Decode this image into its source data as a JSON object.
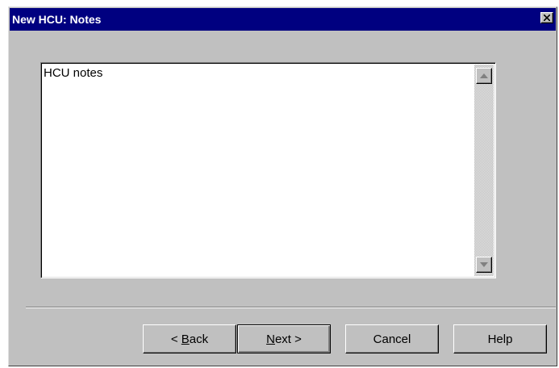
{
  "window": {
    "title": "New HCU: Notes"
  },
  "notes": {
    "value": "HCU notes"
  },
  "buttons": {
    "back": {
      "prefix": "< ",
      "mnemonic": "B",
      "rest": "ack"
    },
    "next": {
      "mnemonic": "N",
      "rest": "ext >"
    },
    "cancel": "Cancel",
    "help": "Help"
  },
  "icons": {
    "close": "close-icon",
    "scroll_up": "arrow-up-icon",
    "scroll_down": "arrow-down-icon"
  },
  "colors": {
    "titlebar": "#000080",
    "face": "#c0c0c0",
    "field": "#ffffff"
  }
}
